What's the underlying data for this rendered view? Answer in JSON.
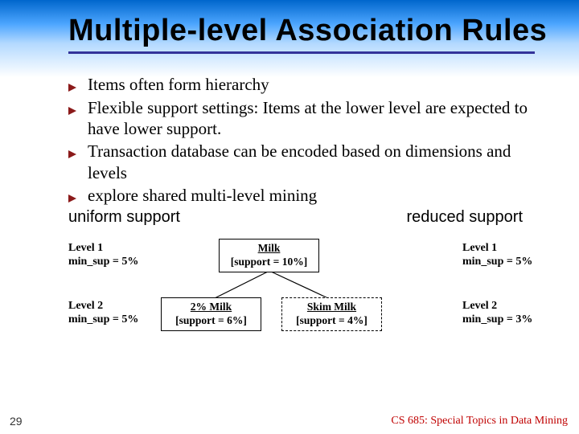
{
  "title": "Multiple-level Association Rules",
  "bullets": [
    "Items often form hierarchy",
    "Flexible support settings: Items at the lower level are expected to have lower support.",
    "Transaction database can be encoded based on dimensions and levels",
    "explore shared multi-level mining"
  ],
  "support": {
    "uniform": "uniform support",
    "reduced": "reduced support"
  },
  "diagram": {
    "left_level1_a": "Level 1",
    "left_level1_b": "min_sup = 5%",
    "left_level2_a": "Level 2",
    "left_level2_b": "min_sup = 5%",
    "right_level1_a": "Level 1",
    "right_level1_b": "min_sup = 5%",
    "right_level2_a": "Level 2",
    "right_level2_b": "min_sup = 3%",
    "milk_name": "Milk",
    "milk_sup": "[support = 10%]",
    "milk2_name": "2% Milk",
    "milk2_sup": "[support = 6%]",
    "skim_name": "Skim Milk",
    "skim_sup": "[support = 4%]"
  },
  "slide_number": "29",
  "footer": "CS 685: Special Topics in Data Mining"
}
